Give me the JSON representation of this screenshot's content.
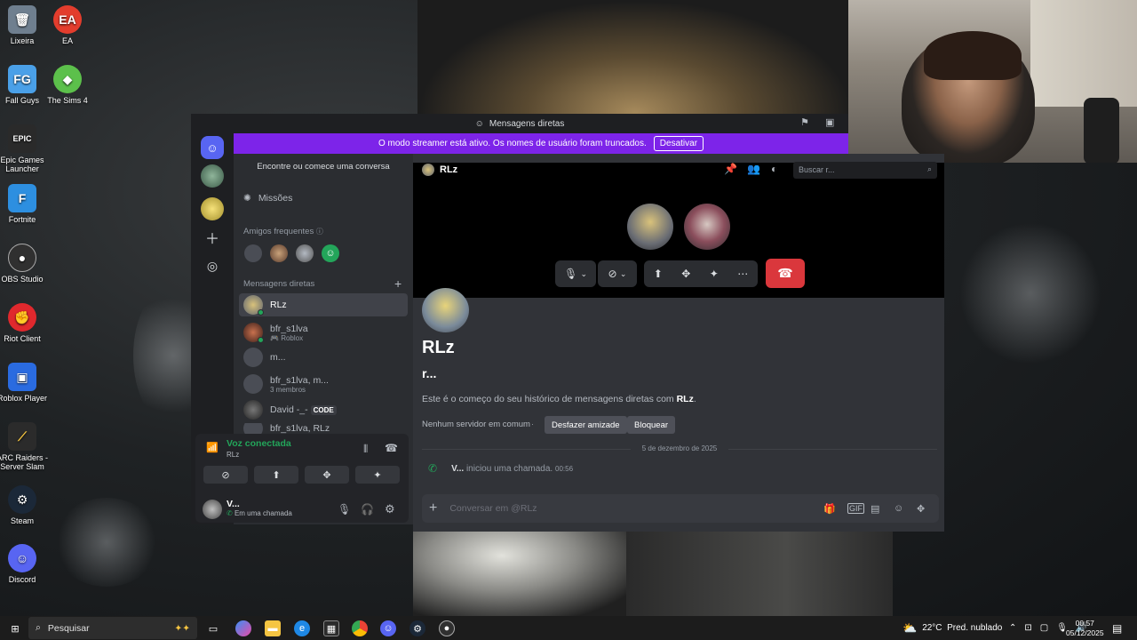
{
  "desktop": {
    "icons": [
      {
        "label": "Lixeira",
        "icon": "recycle-bin-icon",
        "color": "#6f7f8f"
      },
      {
        "label": "EA",
        "icon": "ea-icon",
        "color": "#e33d2d"
      },
      {
        "label": "Fall Guys",
        "icon": "fall-guys-icon",
        "color": "#4aa0e8"
      },
      {
        "label": "The Sims 4",
        "icon": "sims-icon",
        "color": "#5cc04b"
      },
      {
        "label": "Epic Games Launcher",
        "icon": "epic-icon",
        "color": "#2a2a2a"
      },
      {
        "label": "Fortnite",
        "icon": "fortnite-icon",
        "color": "#2d8fe0"
      },
      {
        "label": "OBS Studio",
        "icon": "obs-icon",
        "color": "#303030"
      },
      {
        "label": "Riot Client",
        "icon": "riot-icon",
        "color": "#e0282d"
      },
      {
        "label": "Roblox Player",
        "icon": "roblox-icon",
        "color": "#2a6be0"
      },
      {
        "label": "ARC Raiders - Server Slam",
        "icon": "arc-raiders-icon",
        "color": "#2b2b2b"
      },
      {
        "label": "Steam",
        "icon": "steam-icon",
        "color": "#1b2838"
      },
      {
        "label": "Discord",
        "icon": "discord-icon",
        "color": "#5865f2"
      }
    ]
  },
  "window": {
    "title": "Mensagens diretas",
    "streamer_text": "O modo streamer está ativo. Os nomes de usuário foram truncados.",
    "streamer_button": "Desativar"
  },
  "sidebar": {
    "find_conversation": "Encontre ou comece uma conversa",
    "missions": "Missões",
    "frequent_friends": "Amigos frequentes",
    "direct_messages": "Mensagens diretas",
    "dms": [
      {
        "name": "RLz",
        "sub": ""
      },
      {
        "name": "bfr_s1lva",
        "sub": "Roblox"
      },
      {
        "name": "m...",
        "sub": ""
      },
      {
        "name": "bfr_s1lva, m...",
        "sub": "3 membros"
      },
      {
        "name": "David -_-",
        "sub": "",
        "badge": "CODE"
      },
      {
        "name": "bfr_s1lva, RLz",
        "sub": ""
      }
    ]
  },
  "voice": {
    "status": "Voz conectada",
    "channel": "RLz"
  },
  "user": {
    "name": "V...",
    "status": "Em uma chamada"
  },
  "chat": {
    "name": "RLz",
    "search_placeholder": "Buscar r...",
    "profile_name": "RLz",
    "profile_sub": "r...",
    "intro_prefix": "Este é o começo do seu histórico de mensagens diretas com ",
    "intro_name": "RLz",
    "intro_suffix": ".",
    "no_server": "Nenhum servidor em comum",
    "undo_friend": "Desfazer amizade",
    "block": "Bloquear",
    "date": "5 de dezembro de 2025",
    "call_user": "V...",
    "call_text": "iniciou uma chamada.",
    "call_time": "00:56",
    "composer_placeholder": "Conversar em @RLz"
  },
  "taskbar": {
    "search": "Pesquisar",
    "weather": "22°C",
    "weather_desc": "Pred. nublado",
    "time": "00:57",
    "date": "05/12/2025"
  },
  "colors": {
    "accent": "#5865f2",
    "streamer": "#7d24e9",
    "online": "#23a55a",
    "danger": "#da373c"
  }
}
